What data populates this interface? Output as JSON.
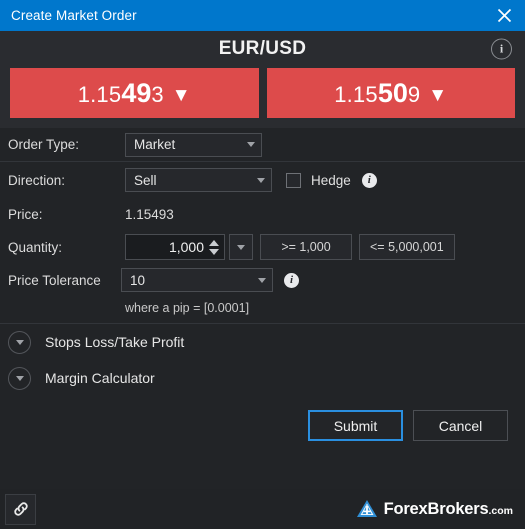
{
  "titlebar": {
    "title": "Create Market Order",
    "close_icon": "close-icon"
  },
  "quote": {
    "pair": "EUR/USD",
    "info_icon": "info-icon",
    "bid": {
      "prefix": "1.15",
      "pips": "49",
      "suffix": "3",
      "arrow": "▼",
      "full": "1.15493"
    },
    "ask": {
      "prefix": "1.15",
      "pips": "50",
      "suffix": "9",
      "arrow": "▼",
      "full": "1.15509"
    },
    "direction_color": "#dd4b4b"
  },
  "form": {
    "order_type": {
      "label": "Order Type:",
      "value": "Market"
    },
    "direction": {
      "label": "Direction:",
      "value": "Sell"
    },
    "hedge": {
      "label": "Hedge",
      "checked": false
    },
    "price": {
      "label": "Price:",
      "value": "1.15493"
    },
    "quantity": {
      "label": "Quantity:",
      "value": "1,000",
      "min_button": ">= 1,000",
      "max_button": "<= 5,000,001"
    },
    "price_tolerance": {
      "label": "Price Tolerance",
      "value": "10"
    },
    "pip_note": "where a pip = [0.0001]"
  },
  "sections": [
    {
      "label": "Stops Loss/Take Profit",
      "expanded": false
    },
    {
      "label": "Margin Calculator",
      "expanded": false
    }
  ],
  "actions": {
    "submit": "Submit",
    "cancel": "Cancel"
  },
  "bottom": {
    "link_icon": "link-icon",
    "watermark_name": "ForexBrokers",
    "watermark_tld": ".com",
    "logo_icon": "forexbrokers-triangle-logo"
  },
  "colors": {
    "accent_blue": "#0077cc",
    "sell_red": "#dd4b4b",
    "focus_blue": "#2a8fe0",
    "window_bg": "#222427",
    "header_bg": "#2a2c30"
  }
}
